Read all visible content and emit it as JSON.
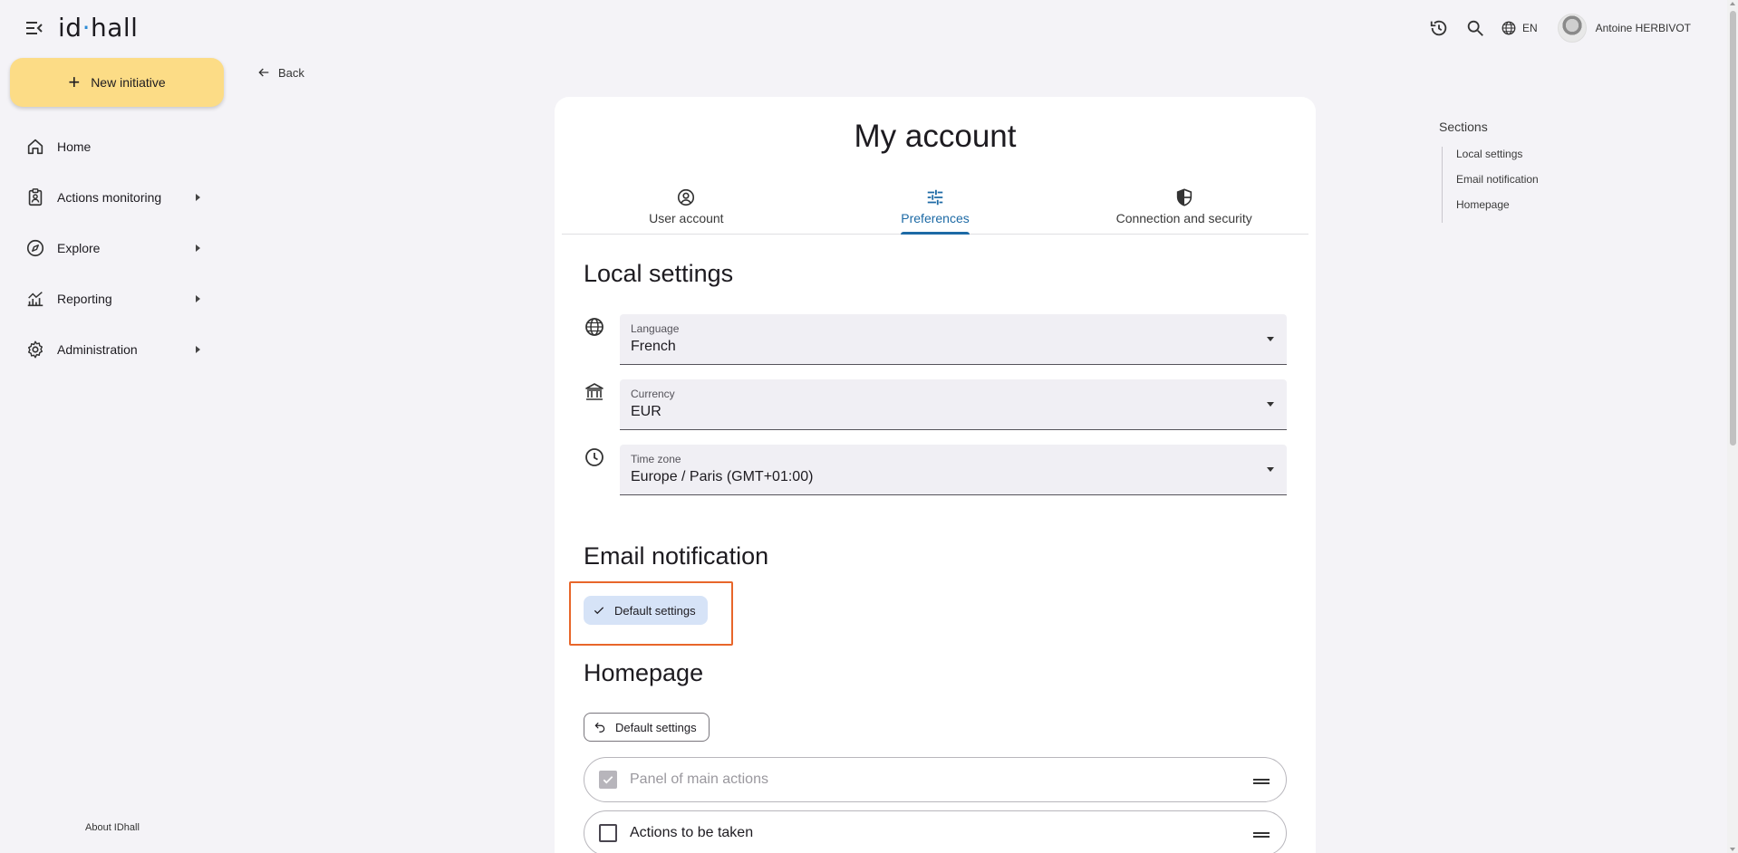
{
  "app": {
    "logo_text_pre": "id",
    "logo_text_mid": "h",
    "logo_text_post": "all",
    "colors": {
      "accent": "#1d6aa5",
      "new_button": "#fcdc86",
      "highlight": "#e8662a",
      "chip_selected": "#d6e3f7"
    }
  },
  "topbar": {
    "icons": [
      "menu-collapse-icon",
      "history-icon",
      "search-icon",
      "globe-icon"
    ],
    "language": "EN",
    "user_name": "Antoine HERBIVOT"
  },
  "sidebar": {
    "new_button_label": "New initiative",
    "items": [
      {
        "label": "Home",
        "icon": "home-icon",
        "expandable": false
      },
      {
        "label": "Actions monitoring",
        "icon": "clipboard-user-icon",
        "expandable": true
      },
      {
        "label": "Explore",
        "icon": "compass-icon",
        "expandable": true
      },
      {
        "label": "Reporting",
        "icon": "chart-icon",
        "expandable": true
      },
      {
        "label": "Administration",
        "icon": "gear-icon",
        "expandable": true
      }
    ],
    "about_label": "About IDhall"
  },
  "back_label": "Back",
  "page": {
    "title": "My account",
    "tabs": [
      {
        "label": "User account",
        "icon": "user-circle-icon",
        "active": false
      },
      {
        "label": "Preferences",
        "icon": "sliders-icon",
        "active": true
      },
      {
        "label": "Connection and security",
        "icon": "shield-icon",
        "active": false
      }
    ],
    "local_settings": {
      "title": "Local settings",
      "fields": [
        {
          "label": "Language",
          "value": "French",
          "icon": "globe-icon"
        },
        {
          "label": "Currency",
          "value": "EUR",
          "icon": "bank-icon"
        },
        {
          "label": "Time zone",
          "value": "Europe / Paris (GMT+01:00)",
          "icon": "clock-icon"
        }
      ]
    },
    "email_notification": {
      "title": "Email notification",
      "default_settings_label": "Default settings"
    },
    "homepage": {
      "title": "Homepage",
      "reset_label": "Default settings",
      "items": [
        {
          "label": "Panel of main actions",
          "checked": true,
          "disabled": true
        },
        {
          "label": "Actions to be taken",
          "checked": false,
          "disabled": false
        }
      ]
    }
  },
  "toc": {
    "title": "Sections",
    "items": [
      "Local settings",
      "Email notification",
      "Homepage"
    ]
  }
}
